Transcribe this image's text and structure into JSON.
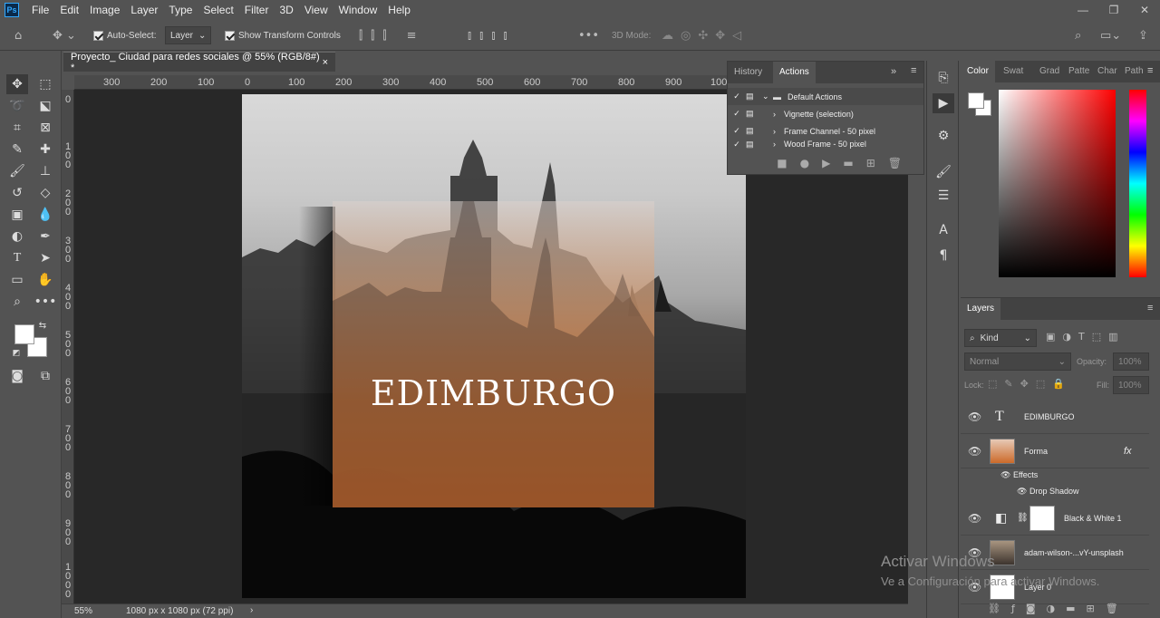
{
  "app": {
    "logo": "Ps"
  },
  "menu": [
    "File",
    "Edit",
    "Image",
    "Layer",
    "Type",
    "Select",
    "Filter",
    "3D",
    "View",
    "Window",
    "Help"
  ],
  "window_controls": [
    "minimize-icon",
    "restore-icon",
    "close-icon"
  ],
  "options": {
    "auto_select_label": "Auto-Select:",
    "auto_select_value": "Layer",
    "transform_label": "Show Transform Controls",
    "mode_3d_label": "3D Mode:"
  },
  "document": {
    "tab_title": "Proyecto_ Ciudad para redes sociales @ 55% (RGB/8#) *",
    "close_glyph": "×",
    "canvas_text": "EDIMBURGO"
  },
  "rulers": {
    "h": [
      "300",
      "200",
      "100",
      "0",
      "100",
      "200",
      "300",
      "400",
      "500",
      "600",
      "700",
      "800",
      "900",
      "100"
    ],
    "v": [
      "0",
      "1\n0\n0",
      "2\n0\n0",
      "3\n0\n0",
      "4\n0\n0",
      "5\n0\n0",
      "6\n0\n0",
      "7\n0\n0",
      "8\n0\n0",
      "9\n0\n0",
      "1\n0\n0\n0"
    ]
  },
  "status": {
    "zoom": "55%",
    "dims": "1080 px x 1080 px (72 ppi)"
  },
  "actions_panel": {
    "tabs": [
      "History",
      "Actions"
    ],
    "active_tab": "Actions",
    "rows": [
      {
        "label": "Default Actions",
        "kind": "set"
      },
      {
        "label": "Vignette (selection)",
        "kind": "action"
      },
      {
        "label": "Frame Channel - 50 pixel",
        "kind": "action"
      },
      {
        "label": "Wood Frame - 50 pixel",
        "kind": "action"
      }
    ]
  },
  "color_panel": {
    "tabs": [
      "Color",
      "Swat",
      "Grad",
      "Patte",
      "Char",
      "Path"
    ],
    "active_tab": "Color"
  },
  "layers_panel": {
    "title": "Layers",
    "filter_kind": "Kind",
    "blend_mode": "Normal",
    "opacity_label": "Opacity:",
    "opacity_value": "100%",
    "lock_label": "Lock:",
    "fill_label": "Fill:",
    "fill_value": "100%",
    "layers": [
      {
        "name": "EDIMBURGO",
        "type": "text"
      },
      {
        "name": "Forma",
        "type": "shape",
        "fx": "fx"
      },
      {
        "name": "Effects",
        "type": "effects"
      },
      {
        "name": "Drop Shadow",
        "type": "effect"
      },
      {
        "name": "Black & White 1",
        "type": "adjustment"
      },
      {
        "name": "adam-wilson-...vY-unsplash",
        "type": "image"
      },
      {
        "name": "Layer 0",
        "type": "fill"
      }
    ]
  },
  "watermark": {
    "line1": "Activar Windows",
    "line2": "Ve a Configuración para activar Windows."
  },
  "colors": {
    "bg": "#535353",
    "workspace": "#282828",
    "accent": "#cc6a2a"
  }
}
